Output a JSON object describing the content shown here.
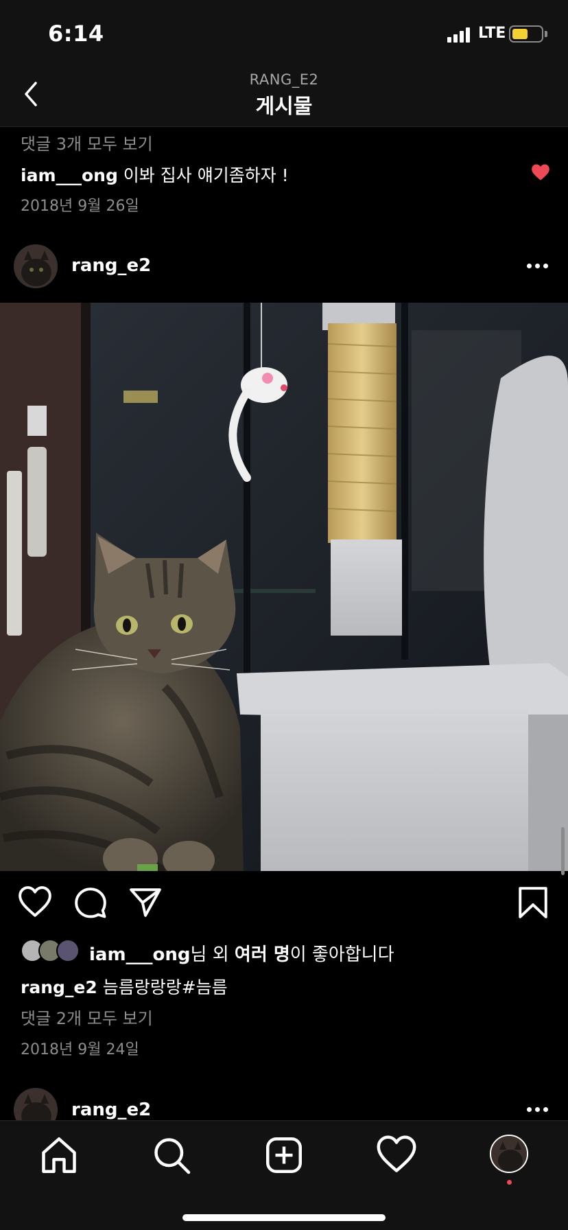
{
  "status_bar": {
    "time": "6:14",
    "network": "LTE",
    "battery_level": 0.55,
    "signal_bars": 4
  },
  "header": {
    "subtitle": "RANG_E2",
    "title": "게시물"
  },
  "previous_post": {
    "view_comments": "댓글 3개 모두 보기",
    "comment_user": "iam___ong",
    "comment_text": " 이봐 집사 얘기좀하자 !",
    "comment_liked": true,
    "date": "2018년 9월 26일"
  },
  "post": {
    "username": "rang_e2",
    "likes_user": "iam___ong",
    "likes_mid": "님 외 ",
    "likes_bold": "여러 명",
    "likes_end": "이 좋아합니다",
    "caption_user": "rang_e2",
    "caption_text": " 늠름랑랑랑#늠름",
    "view_comments": "댓글 2개 모두 보기",
    "date": "2018년 9월 24일"
  },
  "next_post": {
    "username": "rang_e2"
  },
  "colors": {
    "background": "#000000",
    "bar": "#121212",
    "secondary_text": "#8e8e8e",
    "like_red": "#ed4956"
  },
  "icons": {
    "back": "chevron-left-icon",
    "more": "more-horizontal-icon",
    "like": "heart-icon",
    "comment": "comment-icon",
    "share": "paper-plane-icon",
    "save": "bookmark-icon",
    "home": "home-icon",
    "search": "search-icon",
    "add": "plus-square-icon",
    "activity": "heart-icon"
  }
}
